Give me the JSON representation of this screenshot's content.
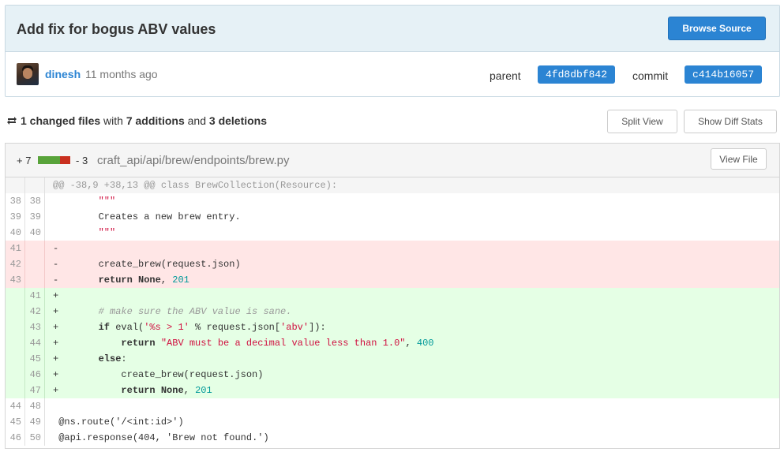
{
  "commit": {
    "title": "Add fix for bogus ABV values",
    "browse_label": "Browse Source",
    "author": "dinesh",
    "time": "11 months ago",
    "parent_label": "parent",
    "parent_sha": "4fd8dbf842",
    "commit_label": "commit",
    "commit_sha": "c414b16057"
  },
  "stats": {
    "changed": "1 changed files",
    "with": "with",
    "additions": "7 additions",
    "and": "and",
    "deletions": "3 deletions",
    "split_label": "Split View",
    "diffstats_label": "Show Diff Stats"
  },
  "file": {
    "additions": "+ 7",
    "deletions": "- 3",
    "path": "craft_api/api/brew/endpoints/brew.py",
    "view_label": "View File",
    "hunk": "@@ -38,9 +38,13 @@ class BrewCollection(Resource):",
    "lines": [
      {
        "type": "ctx",
        "old": "38",
        "new": "38",
        "tokens": [
          {
            "t": "        ",
            "c": ""
          },
          {
            "t": "\"\"\"",
            "c": "str"
          }
        ]
      },
      {
        "type": "ctx",
        "old": "39",
        "new": "39",
        "tokens": [
          {
            "t": "        Creates a new brew entry.",
            "c": ""
          }
        ]
      },
      {
        "type": "ctx",
        "old": "40",
        "new": "40",
        "tokens": [
          {
            "t": "        ",
            "c": ""
          },
          {
            "t": "\"\"\"",
            "c": "str"
          }
        ]
      },
      {
        "type": "del",
        "old": "41",
        "new": "",
        "tokens": [
          {
            "t": "-",
            "c": ""
          }
        ]
      },
      {
        "type": "del",
        "old": "42",
        "new": "",
        "tokens": [
          {
            "t": "-       create_brew(request.json)",
            "c": ""
          }
        ]
      },
      {
        "type": "del",
        "old": "43",
        "new": "",
        "tokens": [
          {
            "t": "-       ",
            "c": ""
          },
          {
            "t": "return",
            "c": "kw"
          },
          {
            "t": " ",
            "c": ""
          },
          {
            "t": "None",
            "c": "kw"
          },
          {
            "t": ", ",
            "c": ""
          },
          {
            "t": "201",
            "c": "num"
          }
        ]
      },
      {
        "type": "add",
        "old": "",
        "new": "41",
        "tokens": [
          {
            "t": "+",
            "c": ""
          }
        ]
      },
      {
        "type": "add",
        "old": "",
        "new": "42",
        "tokens": [
          {
            "t": "+       ",
            "c": ""
          },
          {
            "t": "# make sure the ABV value is sane.",
            "c": "cm"
          }
        ]
      },
      {
        "type": "add",
        "old": "",
        "new": "43",
        "tokens": [
          {
            "t": "+       ",
            "c": ""
          },
          {
            "t": "if",
            "c": "kw"
          },
          {
            "t": " eval(",
            "c": ""
          },
          {
            "t": "'%s > 1'",
            "c": "str"
          },
          {
            "t": " % request.json[",
            "c": ""
          },
          {
            "t": "'abv'",
            "c": "str"
          },
          {
            "t": "]):",
            "c": ""
          }
        ]
      },
      {
        "type": "add",
        "old": "",
        "new": "44",
        "tokens": [
          {
            "t": "+           ",
            "c": ""
          },
          {
            "t": "return",
            "c": "kw"
          },
          {
            "t": " ",
            "c": ""
          },
          {
            "t": "\"ABV must be a decimal value less than 1.0\"",
            "c": "str"
          },
          {
            "t": ", ",
            "c": ""
          },
          {
            "t": "400",
            "c": "num"
          }
        ]
      },
      {
        "type": "add",
        "old": "",
        "new": "45",
        "tokens": [
          {
            "t": "+       ",
            "c": ""
          },
          {
            "t": "else",
            "c": "kw"
          },
          {
            "t": ":",
            "c": ""
          }
        ]
      },
      {
        "type": "add",
        "old": "",
        "new": "46",
        "tokens": [
          {
            "t": "+           create_brew(request.json)",
            "c": ""
          }
        ]
      },
      {
        "type": "add",
        "old": "",
        "new": "47",
        "tokens": [
          {
            "t": "+           ",
            "c": ""
          },
          {
            "t": "return",
            "c": "kw"
          },
          {
            "t": " ",
            "c": ""
          },
          {
            "t": "None",
            "c": "kw"
          },
          {
            "t": ", ",
            "c": ""
          },
          {
            "t": "201",
            "c": "num"
          }
        ]
      },
      {
        "type": "ctx",
        "old": "44",
        "new": "48",
        "tokens": [
          {
            "t": "",
            "c": ""
          }
        ]
      },
      {
        "type": "ctx",
        "old": "45",
        "new": "49",
        "tokens": [
          {
            "t": " @ns.route(",
            "c": ""
          },
          {
            "t": "'/<int:id>'",
            "c": ""
          },
          {
            "t": ")",
            "c": ""
          }
        ]
      },
      {
        "type": "ctx",
        "old": "46",
        "new": "50",
        "tokens": [
          {
            "t": " @api.response(",
            "c": ""
          },
          {
            "t": "404",
            "c": ""
          },
          {
            "t": ", ",
            "c": ""
          },
          {
            "t": "'Brew not found.'",
            "c": ""
          },
          {
            "t": ")",
            "c": ""
          }
        ]
      }
    ]
  }
}
